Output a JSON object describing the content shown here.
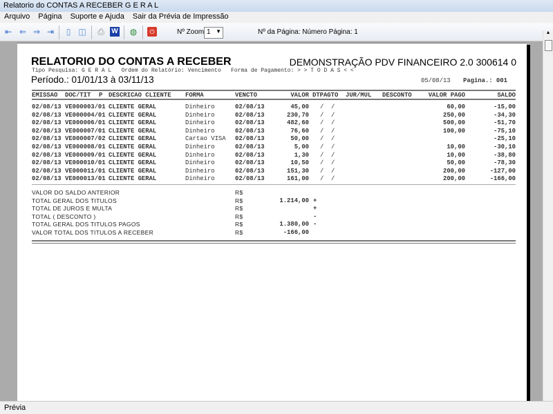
{
  "window": {
    "title": "Relatorio do CONTAS A RECEBER G E R A L"
  },
  "menu": [
    "Arquivo",
    "Página",
    "Suporte e Ajuda",
    "Sair da Prévia de Impressão"
  ],
  "toolbar": {
    "zoom_label": "Nº Zoom",
    "zoom_value": "1",
    "page_label": "Nº da Página: Número Página: 1"
  },
  "report": {
    "title": "RELATORIO DO CONTAS A RECEBER",
    "company": "DEMONSTRAÇÃO PDV FINANCEIRO 2.0 300614 0",
    "filters": "Tipo Pesquisa: G E R A L   Ordem do Relatório: Vencimento   Forma de Pagamento: > > T O D A S < <",
    "period": "Período.: 01/01/13 à 03/11/13",
    "date": "05/08/13",
    "page": "Pagina.: 001",
    "columns": {
      "emissao": "EMISSAO",
      "doc": "DOC/TIT",
      "p": "P",
      "desc": "DESCRICAO CLIENTE",
      "forma": "FORMA",
      "vencto": "VENCTO",
      "valor": "VALOR",
      "dtpagto": "DTPAGTO",
      "jur": "JUR/MUL",
      "desconto": "DESCONTO",
      "pago": "VALOR PAGO",
      "saldo": "SALDO"
    },
    "rows": [
      [
        "02/08/13",
        "VE000003/01",
        "CLIENTE GERAL",
        "Dinheiro",
        "02/08/13",
        "45,00",
        "/  /",
        "60,00",
        "-15,00"
      ],
      [
        "02/08/13",
        "VE000004/01",
        "CLIENTE GERAL",
        "Dinheiro",
        "02/08/13",
        "230,70",
        "/  /",
        "250,00",
        "-34,30"
      ],
      [
        "02/08/13",
        "VE000006/01",
        "CLIENTE GERAL",
        "Dinheiro",
        "02/08/13",
        "482,60",
        "/  /",
        "500,00",
        "-51,70"
      ],
      [
        "02/08/13",
        "VE000007/01",
        "CLIENTE GERAL",
        "Dinheiro",
        "02/08/13",
        "76,60",
        "/  /",
        "100,00",
        "-75,10"
      ],
      [
        "02/08/13",
        "VE000007/02",
        "CLIENTE GERAL",
        "Cartao VISA",
        "02/08/13",
        "50,00",
        "/  /",
        "",
        "-25,10"
      ],
      [
        "02/08/13",
        "VE000008/01",
        "CLIENTE GERAL",
        "Dinheiro",
        "02/08/13",
        "5,00",
        "/  /",
        "10,00",
        "-30,10"
      ],
      [
        "02/08/13",
        "VE000009/01",
        "CLIENTE GERAL",
        "Dinheiro",
        "02/08/13",
        "1,30",
        "/  /",
        "10,00",
        "-38,80"
      ],
      [
        "02/08/13",
        "VE000010/01",
        "CLIENTE GERAL",
        "Dinheiro",
        "02/08/13",
        "10,50",
        "/  /",
        "50,00",
        "-78,30"
      ],
      [
        "02/08/13",
        "VE000011/01",
        "CLIENTE GERAL",
        "Dinheiro",
        "02/08/13",
        "151,30",
        "/  /",
        "200,00",
        "-127,00"
      ],
      [
        "02/08/13",
        "VE000013/01",
        "CLIENTE GERAL",
        "Dinheiro",
        "02/08/13",
        "161,00",
        "/  /",
        "200,00",
        "-166,00"
      ]
    ],
    "summary": [
      {
        "label": "VALOR DO SALDO ANTERIOR",
        "cur": "R$",
        "value": "",
        "sign": ""
      },
      {
        "label": "TOTAL GERAL DOS TITULOS",
        "cur": "R$",
        "value": "1.214,00",
        "sign": "+"
      },
      {
        "label": "TOTAL DE JUROS E MULTA",
        "cur": "R$",
        "value": "",
        "sign": "+"
      },
      {
        "label": "TOTAL ( DESCONTO )",
        "cur": "R$",
        "value": "",
        "sign": "-"
      },
      {
        "label": "TOTAL GERAL DOS TITULOS PAGOS",
        "cur": "R$",
        "value": "1.380,00",
        "sign": "-"
      },
      {
        "label": "VALOR TOTAL DOS TITULOS A RECEBER",
        "cur": "R$",
        "value": "-166,00",
        "sign": ""
      }
    ]
  },
  "status": "Prévia"
}
